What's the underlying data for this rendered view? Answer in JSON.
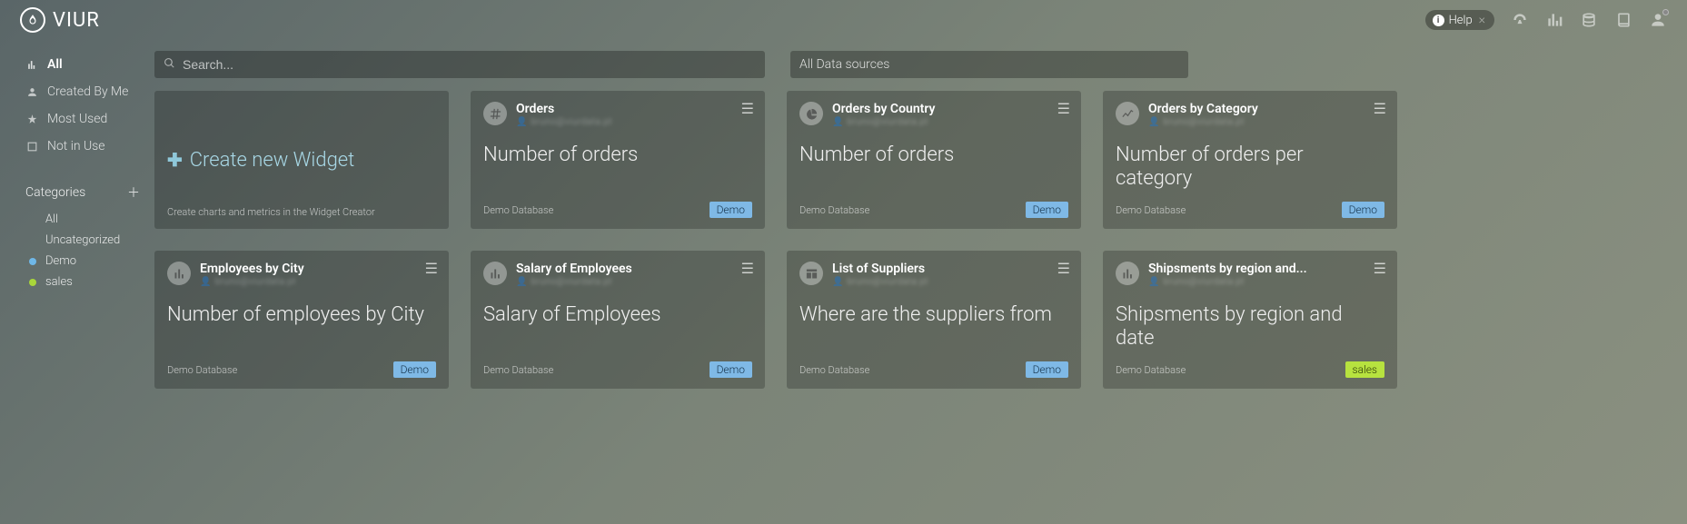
{
  "brand": "VIUR",
  "help": {
    "label": "Help"
  },
  "sidebar": {
    "nav": [
      {
        "label": "All",
        "active": true
      },
      {
        "label": "Created By Me",
        "active": false
      },
      {
        "label": "Most Used",
        "active": false
      },
      {
        "label": "Not in Use",
        "active": false
      }
    ],
    "categories_header": "Categories",
    "categories": [
      {
        "label": "All",
        "color": null
      },
      {
        "label": "Uncategorized",
        "color": null
      },
      {
        "label": "Demo",
        "color": "#6fb8e8"
      },
      {
        "label": "sales",
        "color": "#a9d63a"
      }
    ]
  },
  "search": {
    "placeholder": "Search..."
  },
  "datasource_filter": {
    "label": "All Data sources"
  },
  "create_card": {
    "label": "Create new Widget",
    "desc": "Create charts and metrics in the Widget Creator"
  },
  "widgets": [
    {
      "icon": "hash",
      "title": "Orders",
      "author": "bruno@viurdata.pt",
      "desc": "Number of orders",
      "source": "Demo Database",
      "tag": "Demo",
      "tag_class": "tag-demo"
    },
    {
      "icon": "pie",
      "title": "Orders by Country",
      "author": "bruno@viurdata.pt",
      "desc": "Number of orders",
      "source": "Demo Database",
      "tag": "Demo",
      "tag_class": "tag-demo"
    },
    {
      "icon": "line",
      "title": "Orders by Category",
      "author": "bruno@viurdata.pt",
      "desc": "Number of orders per category",
      "source": "Demo Database",
      "tag": "Demo",
      "tag_class": "tag-demo"
    },
    {
      "icon": "bars",
      "title": "Employees by City",
      "author": "bruno@viurdata.pt",
      "desc": "Number of employees by City",
      "source": "Demo Database",
      "tag": "Demo",
      "tag_class": "tag-demo"
    },
    {
      "icon": "bars",
      "title": "Salary of Employees",
      "author": "bruno@viurdata.pt",
      "desc": "Salary of Employees",
      "source": "Demo Database",
      "tag": "Demo",
      "tag_class": "tag-demo"
    },
    {
      "icon": "table",
      "title": "List of Suppliers",
      "author": "bruno@viurdata.pt",
      "desc": "Where are the suppliers from",
      "source": "Demo Database",
      "tag": "Demo",
      "tag_class": "tag-demo"
    },
    {
      "icon": "bars",
      "title": "Shipsments by region and...",
      "author": "bruno@viurdata.pt",
      "desc": "Shipsments by region and date",
      "source": "Demo Database",
      "tag": "sales",
      "tag_class": "tag-sales"
    }
  ]
}
